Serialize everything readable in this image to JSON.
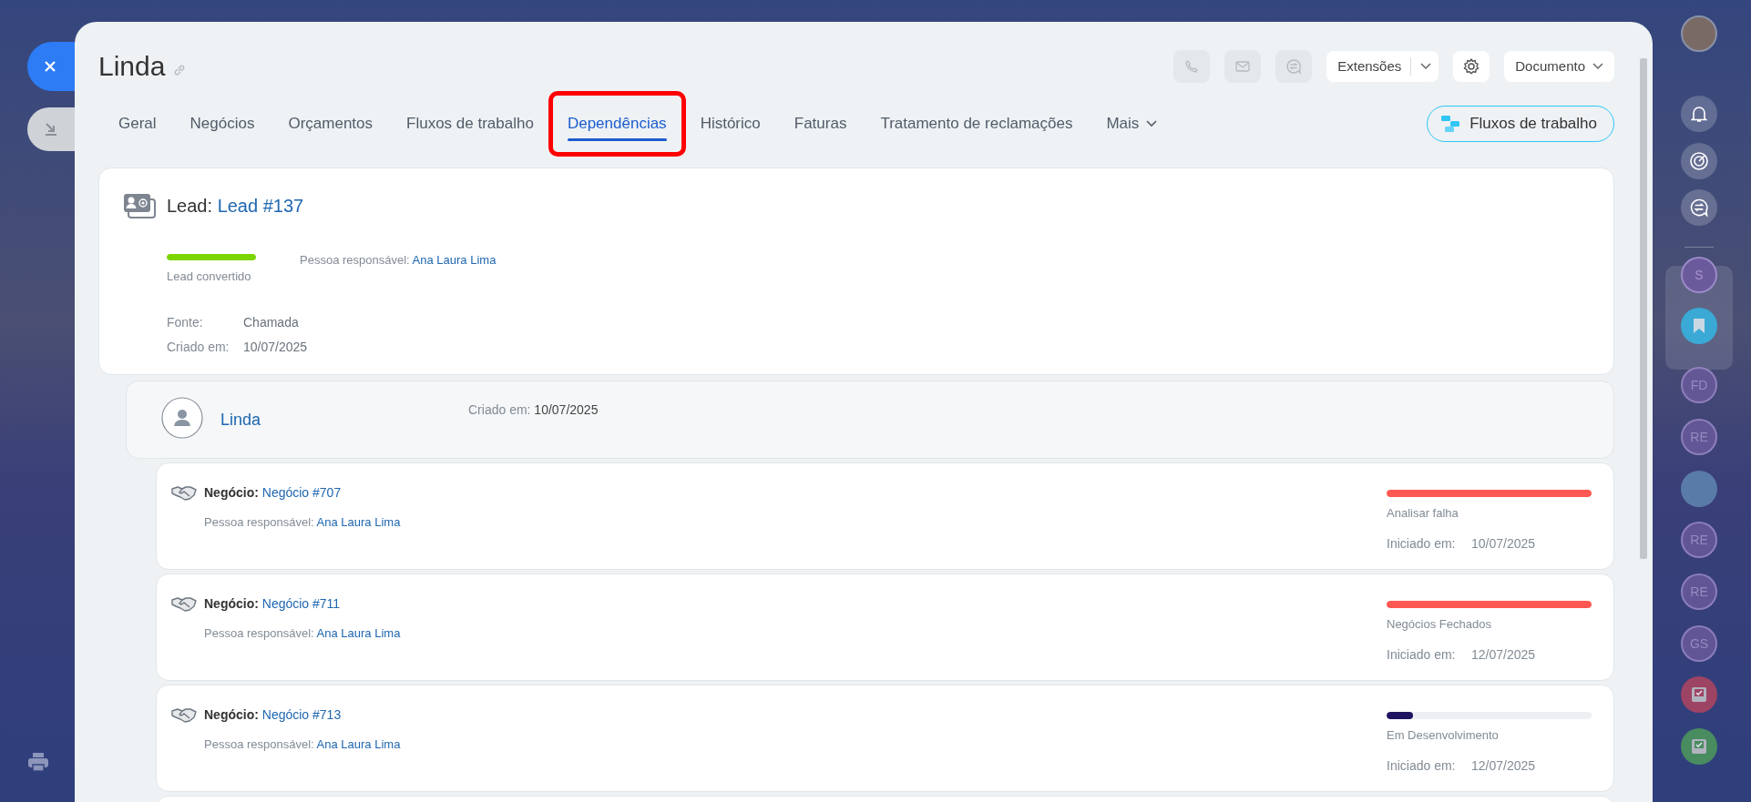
{
  "header": {
    "title": "Linda",
    "extensions": "Extensões",
    "document": "Documento"
  },
  "tabs": [
    {
      "label": "Geral",
      "selected": false,
      "highlighted": false
    },
    {
      "label": "Negócios",
      "selected": false,
      "highlighted": false
    },
    {
      "label": "Orçamentos",
      "selected": false,
      "highlighted": false
    },
    {
      "label": "Fluxos de trabalho",
      "selected": false,
      "highlighted": false
    },
    {
      "label": "Dependências",
      "selected": true,
      "highlighted": true
    },
    {
      "label": "Histórico",
      "selected": false,
      "highlighted": false
    },
    {
      "label": "Faturas",
      "selected": false,
      "highlighted": false
    },
    {
      "label": "Tratamento de reclamações",
      "selected": false,
      "highlighted": false
    },
    {
      "label": "Mais",
      "selected": false,
      "highlighted": false
    }
  ],
  "workflow_button": "Fluxos de trabalho",
  "lead": {
    "label": "Lead:",
    "link": "Lead #137",
    "stage": "Lead convertido",
    "level": 1,
    "color": "#7bd500",
    "responsible_label": "Pessoa responsável:",
    "responsible": "Ana Laura Lima",
    "fields": [
      {
        "label": "Fonte:",
        "value": "Chamada"
      },
      {
        "label": "Criado em:",
        "value": "10/07/2025"
      }
    ]
  },
  "contact": {
    "name": "Linda",
    "created_label": "Criado em:",
    "created": "10/07/2025"
  },
  "deals": [
    {
      "label": "Negócio:",
      "link": "Negócio #707",
      "responsible_label": "Pessoa responsável:",
      "responsible": "Ana Laura Lima",
      "stage": "Analisar falha",
      "level": 1,
      "color": "#ff5752",
      "started_label": "Iniciado em:",
      "started": "10/07/2025"
    },
    {
      "label": "Negócio:",
      "link": "Negócio #711",
      "responsible_label": "Pessoa responsável:",
      "responsible": "Ana Laura Lima",
      "stage": "Negócios Fechados",
      "level": 1,
      "color": "#ff5752",
      "started_label": "Iniciado em:",
      "started": "12/07/2025"
    },
    {
      "label": "Negócio:",
      "link": "Negócio #713",
      "responsible_label": "Pessoa responsável:",
      "responsible": "Ana Laura Lima",
      "stage": "Em Desenvolvimento",
      "level": 0.13,
      "color": "#1e1460",
      "started_label": "Iniciado em:",
      "started": "12/07/2025"
    }
  ],
  "right_bar": {
    "pinned": [
      {
        "kind": "initials",
        "text": "S"
      },
      {
        "kind": "bookmark"
      }
    ],
    "items": [
      {
        "kind": "initials",
        "text": "FD"
      },
      {
        "kind": "initials",
        "text": "RE"
      },
      {
        "kind": "photo"
      },
      {
        "kind": "initials",
        "text": "RE"
      },
      {
        "kind": "initials",
        "text": "RE"
      },
      {
        "kind": "initials",
        "text": "GS"
      },
      {
        "kind": "task-red"
      },
      {
        "kind": "task-green"
      }
    ]
  }
}
